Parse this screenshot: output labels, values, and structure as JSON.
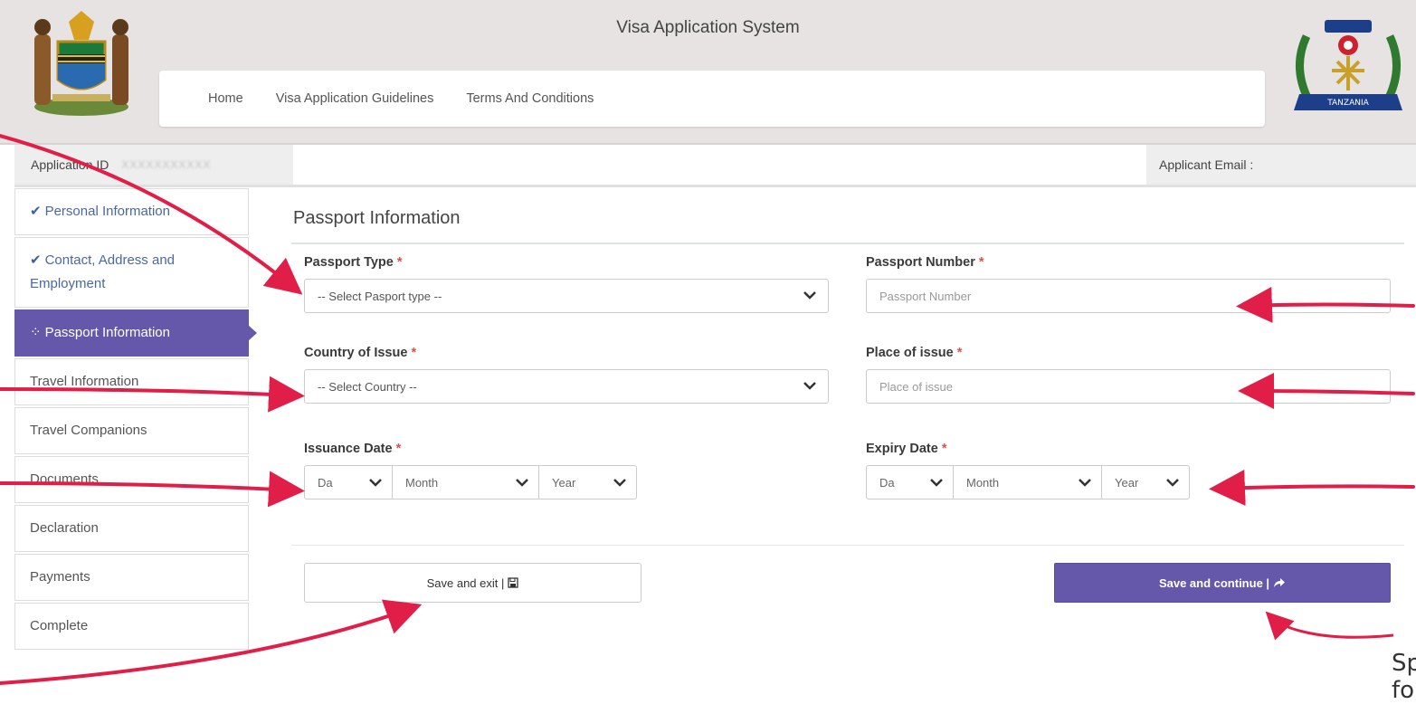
{
  "header": {
    "title": "Visa Application System",
    "nav": [
      {
        "label": "Home"
      },
      {
        "label": "Visa Application Guidelines"
      },
      {
        "label": "Terms And Conditions"
      }
    ],
    "logo_left": "tanzania-coat-of-arms",
    "logo_right_text": "TANZANIA"
  },
  "info_bar": {
    "application_id_label": "Application ID",
    "application_id_value": "XXXXXXXXXXX",
    "applicant_email_label": "Applicant Email :"
  },
  "sidebar": {
    "steps": [
      {
        "label": "Personal Information",
        "status": "done"
      },
      {
        "label": "Contact, Address and Employment",
        "status": "done"
      },
      {
        "label": "Passport Information",
        "status": "active"
      },
      {
        "label": "Travel Information",
        "status": "pending"
      },
      {
        "label": "Travel Companions",
        "status": "pending"
      },
      {
        "label": "Documents",
        "status": "pending"
      },
      {
        "label": "Declaration",
        "status": "pending"
      },
      {
        "label": "Payments",
        "status": "pending"
      },
      {
        "label": "Complete",
        "status": "pending"
      }
    ]
  },
  "form": {
    "section_title": "Passport Information",
    "passport_type": {
      "label": "Passport Type",
      "value": "-- Select Pasport type --"
    },
    "passport_number": {
      "label": "Passport Number",
      "placeholder": "Passport Number"
    },
    "country_of_issue": {
      "label": "Country of Issue",
      "value": "-- Select Country --"
    },
    "place_of_issue": {
      "label": "Place of issue",
      "placeholder": "Place of issue"
    },
    "issuance_date": {
      "label": "Issuance Date",
      "day": "Da",
      "month": "Month",
      "year": "Year"
    },
    "expiry_date": {
      "label": "Expiry Date",
      "day": "Da",
      "month": "Month",
      "year": "Year"
    },
    "required_mark": "*"
  },
  "buttons": {
    "save_exit": "Save and exit |",
    "save_continue": "Save and continue |"
  },
  "annotation": {
    "note_line1": "Sp",
    "note_line2": "for"
  },
  "colors": {
    "accent": "#6558ab",
    "required": "#d9534f",
    "arrow": "#e01e48",
    "done": "#3d5ea8"
  }
}
